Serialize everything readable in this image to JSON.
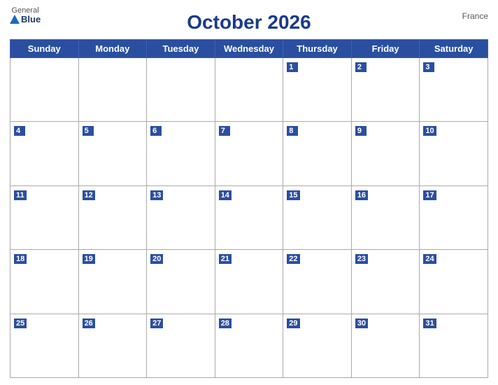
{
  "header": {
    "logo_general": "General",
    "logo_blue": "Blue",
    "title": "October 2026",
    "country": "France"
  },
  "days_of_week": [
    "Sunday",
    "Monday",
    "Tuesday",
    "Wednesday",
    "Thursday",
    "Friday",
    "Saturday"
  ],
  "weeks": [
    [
      null,
      null,
      null,
      null,
      1,
      2,
      3
    ],
    [
      4,
      5,
      6,
      7,
      8,
      9,
      10
    ],
    [
      11,
      12,
      13,
      14,
      15,
      16,
      17
    ],
    [
      18,
      19,
      20,
      21,
      22,
      23,
      24
    ],
    [
      25,
      26,
      27,
      28,
      29,
      30,
      31
    ]
  ]
}
